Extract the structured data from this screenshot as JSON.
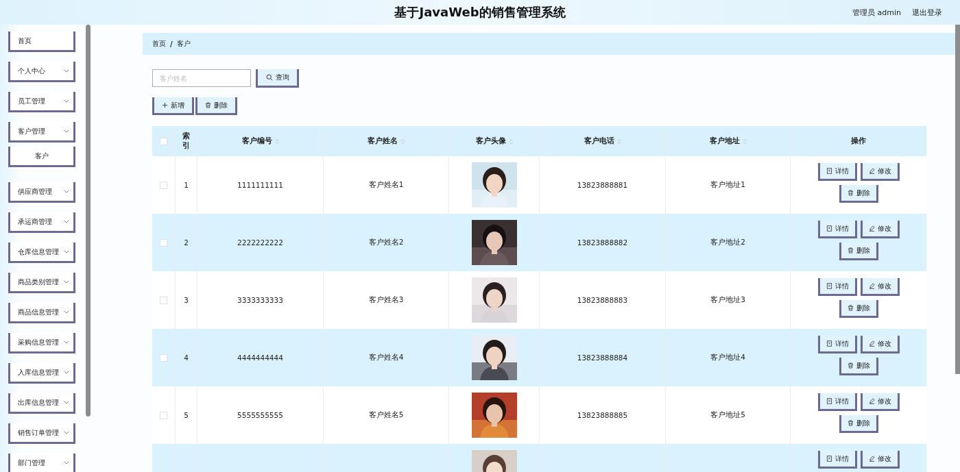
{
  "header": {
    "title": "基于JavaWeb的销售管理系统",
    "user": "管理员 admin",
    "logout": "退出登录"
  },
  "sidebar": {
    "items": [
      {
        "label": "首页",
        "kind": "link"
      },
      {
        "label": "个人中心",
        "kind": "menu"
      },
      {
        "label": "员工管理",
        "kind": "menu"
      },
      {
        "label": "客户管理",
        "kind": "menu",
        "children": [
          {
            "label": "客户"
          }
        ]
      },
      {
        "label": "供应商管理",
        "kind": "menu"
      },
      {
        "label": "承运商管理",
        "kind": "menu"
      },
      {
        "label": "仓库信息管理",
        "kind": "menu"
      },
      {
        "label": "商品类别管理",
        "kind": "menu"
      },
      {
        "label": "商品信息管理",
        "kind": "menu"
      },
      {
        "label": "采购信息管理",
        "kind": "menu"
      },
      {
        "label": "入库信息管理",
        "kind": "menu"
      },
      {
        "label": "出库信息管理",
        "kind": "menu"
      },
      {
        "label": "销售订单管理",
        "kind": "menu"
      },
      {
        "label": "部门管理",
        "kind": "menu"
      }
    ]
  },
  "breadcrumb": {
    "items": [
      "首页",
      "客户"
    ],
    "separator": "/"
  },
  "search": {
    "placeholder": "客户姓名",
    "button": "查询"
  },
  "actions": [
    {
      "kind": "add",
      "label": "新增"
    },
    {
      "kind": "delete",
      "label": "删除"
    }
  ],
  "table": {
    "all_checked": false,
    "columns": [
      {
        "label": "索引",
        "sortable": false
      },
      {
        "label": "客户编号",
        "sortable": true
      },
      {
        "label": "客户姓名",
        "sortable": true
      },
      {
        "label": "客户头像",
        "sortable": true
      },
      {
        "label": "客户电话",
        "sortable": true
      },
      {
        "label": "客户地址",
        "sortable": true
      },
      {
        "label": "操作",
        "sortable": false
      }
    ],
    "rows": [
      {
        "checked": false,
        "index": "1",
        "code": "1111111111",
        "name": "客户姓名1",
        "phone": "13823888881",
        "address": "客户地址1",
        "actions": [
          {
            "kind": "detail",
            "label": "详情"
          },
          {
            "kind": "edit",
            "label": "修改"
          },
          {
            "kind": "delete",
            "label": "删除"
          }
        ]
      },
      {
        "checked": false,
        "index": "2",
        "code": "2222222222",
        "name": "客户姓名2",
        "phone": "13823888882",
        "address": "客户地址2",
        "actions": [
          {
            "kind": "detail",
            "label": "详情"
          },
          {
            "kind": "edit",
            "label": "修改"
          },
          {
            "kind": "delete",
            "label": "删除"
          }
        ]
      },
      {
        "checked": false,
        "index": "3",
        "code": "3333333333",
        "name": "客户姓名3",
        "phone": "13823888883",
        "address": "客户地址3",
        "actions": [
          {
            "kind": "detail",
            "label": "详情"
          },
          {
            "kind": "edit",
            "label": "修改"
          },
          {
            "kind": "delete",
            "label": "删除"
          }
        ]
      },
      {
        "checked": false,
        "index": "4",
        "code": "4444444444",
        "name": "客户姓名4",
        "phone": "13823888884",
        "address": "客户地址4",
        "actions": [
          {
            "kind": "detail",
            "label": "详情"
          },
          {
            "kind": "edit",
            "label": "修改"
          },
          {
            "kind": "delete",
            "label": "删除"
          }
        ]
      },
      {
        "checked": false,
        "index": "5",
        "code": "5555555555",
        "name": "客户姓名5",
        "phone": "13823888885",
        "address": "客户地址5",
        "actions": [
          {
            "kind": "detail",
            "label": "详情"
          },
          {
            "kind": "edit",
            "label": "修改"
          },
          {
            "kind": "delete",
            "label": "删除"
          }
        ]
      },
      {
        "actions": [
          {
            "kind": "detail",
            "label": "详情"
          },
          {
            "kind": "edit",
            "label": "修改"
          }
        ]
      }
    ]
  }
}
